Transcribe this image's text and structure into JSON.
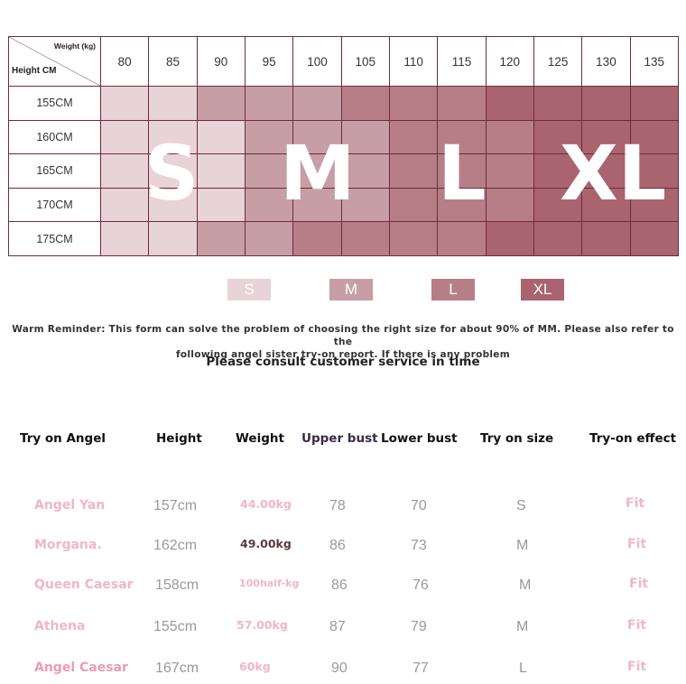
{
  "grid": {
    "weight_label": "Weight (kg)",
    "height_label": "Height CM",
    "weights": [
      "80",
      "85",
      "90",
      "95",
      "100",
      "105",
      "110",
      "115",
      "120",
      "125",
      "130",
      "135"
    ],
    "heights": [
      "155CM",
      "160CM",
      "165CM",
      "170CM",
      "175CM"
    ],
    "cells": [
      [
        "S",
        "S",
        "M",
        "M",
        "M",
        "L",
        "L",
        "L",
        "XL",
        "XL",
        "XL",
        "XL"
      ],
      [
        "S",
        "S",
        "S",
        "M",
        "M",
        "M",
        "L",
        "L",
        "L",
        "XL",
        "XL",
        "XL"
      ],
      [
        "S",
        "S",
        "S",
        "M",
        "M",
        "M",
        "L",
        "L",
        "L",
        "XL",
        "XL",
        "XL"
      ],
      [
        "S",
        "S",
        "S",
        "M",
        "M",
        "M",
        "L",
        "L",
        "L",
        "XL",
        "XL",
        "XL"
      ],
      [
        "S",
        "S",
        "M",
        "M",
        "L",
        "L",
        "L",
        "L",
        "XL",
        "XL",
        "XL",
        "XL"
      ]
    ],
    "big_labels": {
      "s": "S",
      "m": "M",
      "l": "L",
      "xl": "XL"
    }
  },
  "colors": {
    "S": "#e8d3d8",
    "M": "#c79ea6",
    "L": "#b77e88",
    "XL": "#a9646f"
  },
  "legend": [
    "S",
    "M",
    "L",
    "XL"
  ],
  "reminder": {
    "line1": "Warm Reminder: This form can solve the problem of choosing the right size for about 90% of MM. Please also refer to the",
    "line2": "following angel sister try-on report. If there is any problem",
    "line3": "Please consult customer service in time"
  },
  "tryon": {
    "headers": {
      "name": "Try on Angel",
      "height": "Height",
      "weight": "Weight",
      "upper": "Upper bust",
      "lower": "Lower bust",
      "size": "Try on size",
      "effect": "Try-on effect"
    },
    "rows": [
      {
        "name": "Angel Yan",
        "height": "157cm",
        "weight": "44.00kg",
        "upper": "78",
        "lower": "70",
        "size": "S",
        "effect": "Fit"
      },
      {
        "name": "Morgana.",
        "height": "162cm",
        "weight": "49.00kg",
        "upper": "86",
        "lower": "73",
        "size": "M",
        "effect": "Fit"
      },
      {
        "name": "Queen Caesar",
        "height": "158cm",
        "weight": "100half-kg",
        "upper": "86",
        "lower": "76",
        "size": "M",
        "effect": "Fit"
      },
      {
        "name": "Athena",
        "height": "155cm",
        "weight": "57.00kg",
        "upper": "87",
        "lower": "79",
        "size": "M",
        "effect": "Fit"
      },
      {
        "name": "Angel Caesar",
        "height": "167cm",
        "weight": "60kg",
        "upper": "90",
        "lower": "77",
        "size": "L",
        "effect": "Fit"
      }
    ]
  }
}
